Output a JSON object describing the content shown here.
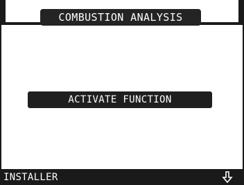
{
  "header": {
    "title": "COMBUSTION ANALYSIS"
  },
  "main": {
    "button_label": "ACTIVATE FUNCTION"
  },
  "footer": {
    "label": "INSTALLER",
    "right_icon": "down-arrow-icon"
  },
  "colors": {
    "background": "#ffffff",
    "panel": "#1a1a1a",
    "text_on_dark": "#ffffff"
  }
}
